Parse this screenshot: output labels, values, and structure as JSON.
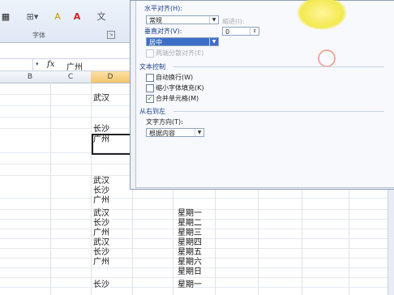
{
  "ribbon": {
    "group_label": "字体",
    "font_color_glyph": "A",
    "fill_glyph": "A",
    "wen_glyph": "文",
    "launcher_glyph": "↘"
  },
  "formula_bar": {
    "fx": "fx",
    "value": "广州"
  },
  "columns": [
    "B",
    "C",
    "D"
  ],
  "cells": {
    "d_top": [
      "武汉",
      "长沙",
      "广州"
    ],
    "d_list": [
      "武汉",
      "长沙",
      "广州",
      "武汉",
      "长沙",
      "广州",
      "武汉",
      "长沙",
      "广州",
      "长沙"
    ],
    "e_list": [
      "星期一",
      "星期二",
      "星期三",
      "星期四",
      "星期五",
      "星期六",
      "星期日",
      "星期一"
    ]
  },
  "dialog": {
    "horizontal_label": "水平对齐(H):",
    "horizontal_value": "常规",
    "indent_label": "缩进(I):",
    "indent_value": "0",
    "vertical_label": "垂直对齐(V):",
    "vertical_value": "居中",
    "justify_distributed_label": "两端分散对齐(E)",
    "text_control_title": "文本控制",
    "wrap_text_label": "自动换行(W)",
    "shrink_to_fit_label": "缩小字体填充(K)",
    "merge_cells_label": "合并单元格(M)",
    "merge_checked": true,
    "rtl_title": "从右到左",
    "text_direction_label": "文字方向(T):",
    "text_direction_value": "根据内容"
  }
}
